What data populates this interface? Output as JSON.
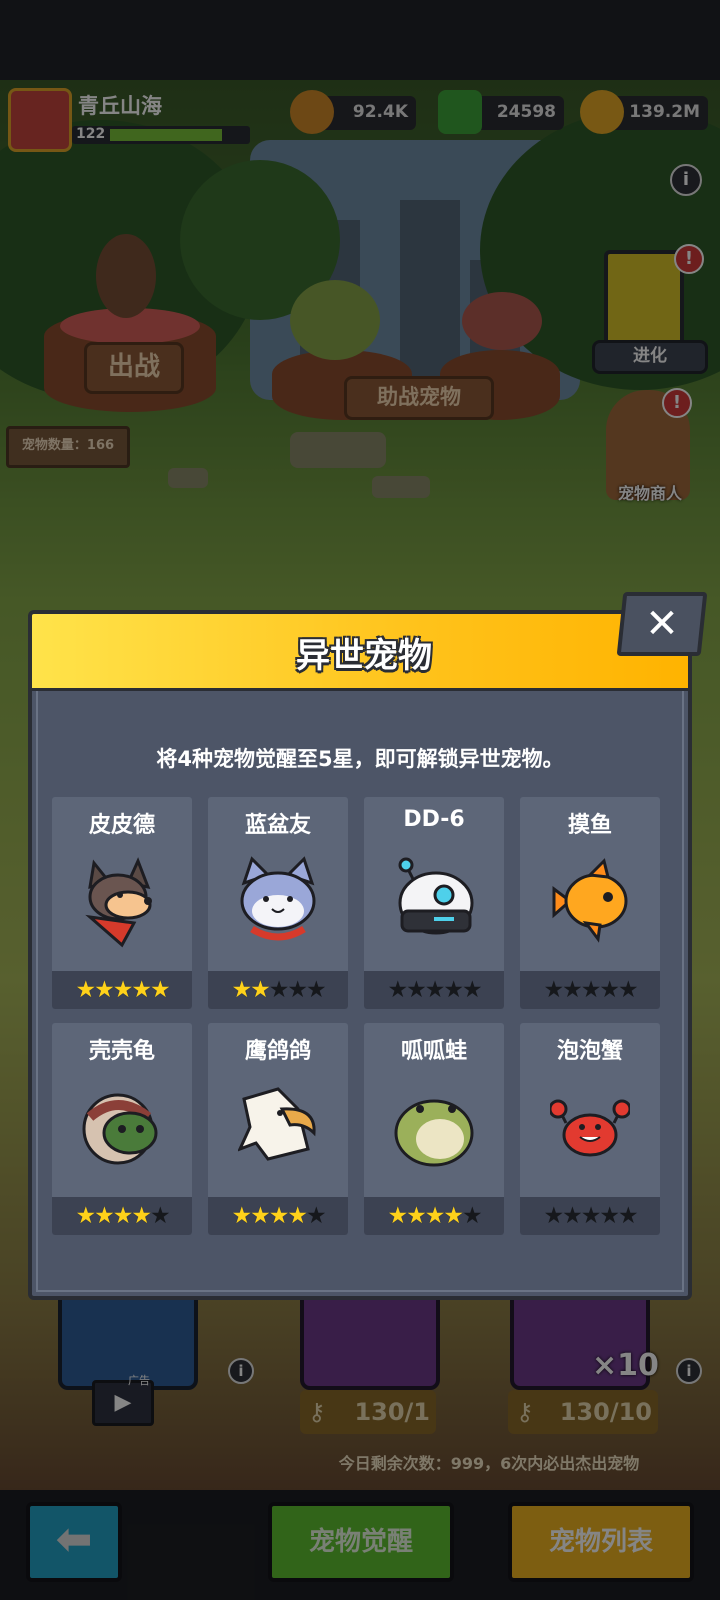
{
  "player": {
    "name": "青丘山海",
    "level": "122"
  },
  "resources": [
    {
      "icon": "coin-icon",
      "value": "92.4K"
    },
    {
      "icon": "green-gem-icon",
      "value": "24598"
    },
    {
      "icon": "gold-key-icon",
      "value": "139.2M"
    }
  ],
  "background": {
    "deploy_label": "出战",
    "assist_label": "助战宠物",
    "pet_count": "宠物数量：166",
    "evolve_label": "进化",
    "merchant_label": "宠物商人",
    "ad_label": "广告",
    "key_count_1": "130/1",
    "key_count_10": "130/10",
    "x10_label": "×10",
    "daily_text": "今日剩余次数：999，6次内必出杰出宠物",
    "awaken_button": "宠物觉醒",
    "list_button": "宠物列表",
    "back_icon": "back-arrow-icon"
  },
  "modal": {
    "title": "异世宠物",
    "description": "将4种宠物觉醒至5星，即可解锁异世宠物。",
    "close_icon": "close-icon",
    "pets": [
      {
        "name": "皮皮德",
        "icon": "husky-dog-icon",
        "stars": 5
      },
      {
        "name": "蓝盆友",
        "icon": "blue-cat-icon",
        "stars": 2
      },
      {
        "name": "DD-6",
        "icon": "robot-icon",
        "stars": 0
      },
      {
        "name": "摸鱼",
        "icon": "goldfish-icon",
        "stars": 0
      },
      {
        "name": "壳壳龟",
        "icon": "turtle-icon",
        "stars": 4
      },
      {
        "name": "鹰鸽鸽",
        "icon": "eagle-icon",
        "stars": 4
      },
      {
        "name": "呱呱蛙",
        "icon": "frog-icon",
        "stars": 4
      },
      {
        "name": "泡泡蟹",
        "icon": "crab-icon",
        "stars": 0
      }
    ],
    "max_stars": 5
  }
}
